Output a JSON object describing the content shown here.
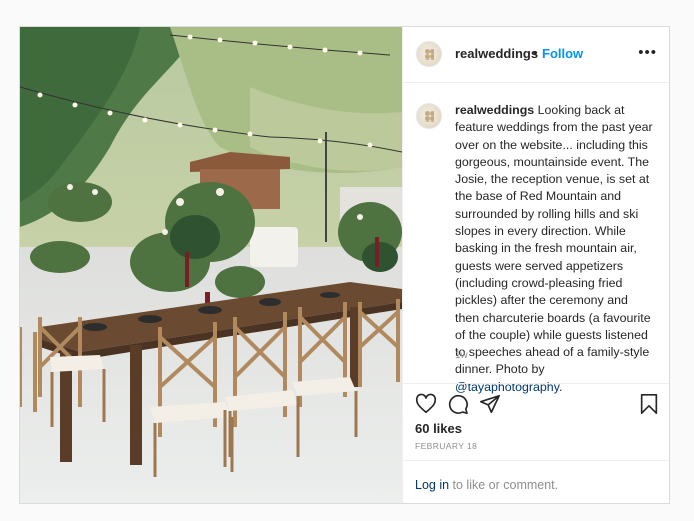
{
  "post": {
    "username": "realweddings",
    "separator": "•",
    "follow_label": "Follow",
    "more_label": "•••",
    "caption": {
      "username": "realweddings",
      "text": "Looking back at feature weddings from the past year over on the website... including this gorgeous, mountainside event. The Josie, the reception venue, is set at the base of Red Mountain and surrounded by rolling hills and ski slopes in every direction. While basking in the fresh mountain air, guests were served appetizers (including crowd-pleasing fried pickles) after the ceremony and then charcuterie boards (a favourite of the couple) while guests listened to speeches ahead of a family-style dinner. Photo by ",
      "mention": "@tayaphotography",
      "end": "."
    },
    "time_ago": "1w",
    "likes": "60 likes",
    "date": "FEBRUARY 18",
    "login_prompt": {
      "link": "Log in",
      "text": " to like or comment."
    }
  },
  "icons": {
    "like": "heart-icon",
    "comment": "comment-bubble-icon",
    "share": "paper-plane-icon",
    "save": "bookmark-icon"
  },
  "colors": {
    "follow": "#0095f6",
    "link": "#00376b",
    "muted": "#8e8e8e",
    "text": "#262626",
    "border": "#dbdbdb"
  }
}
